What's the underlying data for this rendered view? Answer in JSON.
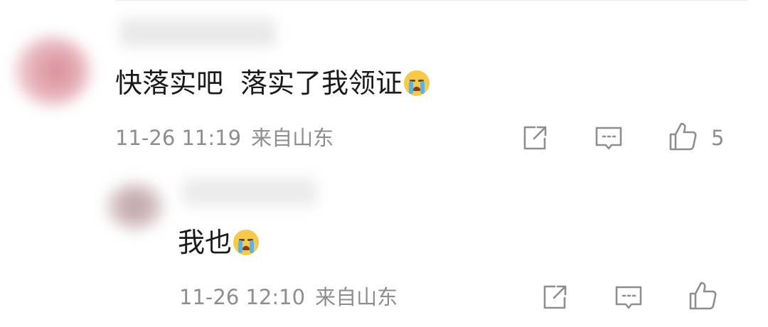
{
  "comments": [
    {
      "text_part1": "快落实吧",
      "text_part2": "落实了我领证",
      "emoji": "crying-face",
      "date": "11-26 11:19",
      "location": "来自山东",
      "like_count": "5"
    },
    {
      "text_part1": "我也",
      "emoji": "crying-face",
      "date": "11-26 12:10",
      "location": "来自山东",
      "like_count": ""
    }
  ],
  "colors": {
    "text": "#1a1a1a",
    "meta": "#8e8e8e",
    "icon": "#8e8e8e",
    "emoji_face": "#f7c94a",
    "emoji_tear": "#58b4f0"
  }
}
